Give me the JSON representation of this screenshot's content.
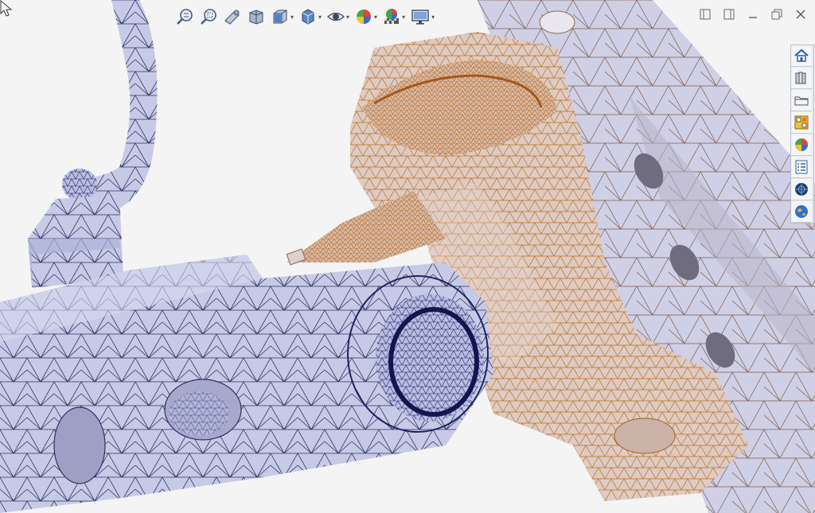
{
  "app": {
    "title": "",
    "view": "mesh-3d-viewport"
  },
  "heads_up_toolbar": {
    "items": [
      {
        "name": "zoom-to-fit",
        "icon": "zoom-fit-icon",
        "has_dropdown": false
      },
      {
        "name": "zoom-to-area",
        "icon": "zoom-area-icon",
        "has_dropdown": false
      },
      {
        "name": "previous-view",
        "icon": "previous-view-icon",
        "has_dropdown": false
      },
      {
        "name": "section-view",
        "icon": "section-view-icon",
        "has_dropdown": false
      },
      {
        "name": "view-orientation",
        "icon": "view-orientation-icon",
        "has_dropdown": true
      },
      {
        "name": "display-style",
        "icon": "display-style-icon",
        "has_dropdown": true
      },
      {
        "name": "hide-show-items",
        "icon": "eye-icon",
        "has_dropdown": true
      },
      {
        "name": "edit-appearance",
        "icon": "appearance-ball-icon",
        "has_dropdown": true
      },
      {
        "name": "apply-scene",
        "icon": "scene-icon",
        "has_dropdown": true
      },
      {
        "name": "view-settings",
        "icon": "monitor-icon",
        "has_dropdown": true
      }
    ]
  },
  "window_controls": [
    {
      "name": "tile-left",
      "icon": "tile-left-icon"
    },
    {
      "name": "tile-right",
      "icon": "tile-right-icon"
    },
    {
      "name": "minimize",
      "icon": "minimize-icon"
    },
    {
      "name": "restore",
      "icon": "restore-icon"
    },
    {
      "name": "close",
      "icon": "close-icon"
    }
  ],
  "task_pane": {
    "tabs": [
      {
        "name": "home",
        "icon": "home-icon"
      },
      {
        "name": "design-library",
        "icon": "books-icon"
      },
      {
        "name": "file-explorer",
        "icon": "folder-icon"
      },
      {
        "name": "view-palette",
        "icon": "view-palette-icon"
      },
      {
        "name": "appearances",
        "icon": "appearance-ball-icon"
      },
      {
        "name": "custom-properties",
        "icon": "properties-list-icon"
      },
      {
        "name": "resources",
        "icon": "globe-dark-icon"
      },
      {
        "name": "community",
        "icon": "globe-blue-icon"
      }
    ]
  },
  "colors": {
    "background": "#f4f4f5",
    "mesh_blue_fill": "#c5c8e3",
    "mesh_blue_edge": "#2e3060",
    "mesh_orange_fill": "#dcc8bf",
    "mesh_orange_edge": "#c2711e"
  }
}
